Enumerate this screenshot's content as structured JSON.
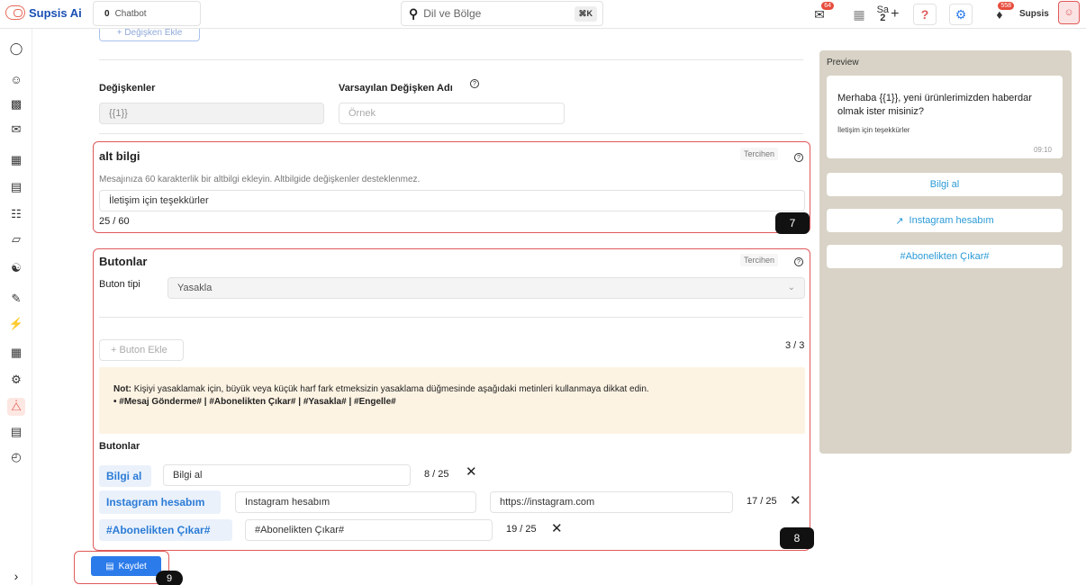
{
  "topbar": {
    "brand": "Supsis Ai",
    "chatbot_count": "0",
    "chatbot_label": "Chatbot",
    "search_placeholder": "Dil ve Bölge",
    "search_shortcut": "⌘K",
    "mail_badge": "64",
    "bell_badge": "558",
    "lang_label": "Sa",
    "lang_sub": "2",
    "user_name": "Supsis"
  },
  "previous": {
    "add_variable_label": "+ Değişken Ekle"
  },
  "variables": {
    "label": "Değişkenler",
    "default_label": "Varsayılan Değişken Adı",
    "value": "{{1}}",
    "default_placeholder": "Örnek"
  },
  "footer_section": {
    "title": "alt bilgi",
    "badge": "Tercihen",
    "description": "Mesajınıza 60 karakterlik bir altbilgi ekleyin. Altbilgide değişkenler desteklenmez.",
    "value": "İletişim için teşekkürler",
    "counter": "25 / 60",
    "tag": "7"
  },
  "buttons_section": {
    "title": "Butonlar",
    "badge": "Tercihen",
    "type_label": "Buton tipi",
    "type_value": "Yasakla",
    "add_button_label": "+ Buton Ekle",
    "count": "3 / 3",
    "note_prefix": "Not:",
    "note_text": " Kişiyi yasaklamak için, büyük veya küçük harf fark etmeksizin yasaklama düğmesinde aşağıdaki metinleri kullanmaya dikkat edin.",
    "note_bullet": "#Mesaj Gönderme# | #Abonelikten Çıkar# | #Yasakla# | #Engelle#",
    "list_label": "Butonlar",
    "items": [
      {
        "chip": "Bilgi al",
        "text": "Bilgi al",
        "counter": "8 / 25"
      },
      {
        "chip": "Instagram hesabım",
        "text": "Instagram hesabım",
        "url": "https://instagram.com",
        "counter": "17 / 25"
      },
      {
        "chip": "#Abonelikten Çıkar#",
        "text": "#Abonelikten Çıkar#",
        "counter": "19 / 25"
      }
    ],
    "tag": "8"
  },
  "save": {
    "label": "Kaydet",
    "tag": "9"
  },
  "preview": {
    "title": "Preview",
    "message": "Merhaba {{1}}, yeni ürünlerimizden haberdar olmak ister misiniz?",
    "footer": "İletişim için teşekkürler",
    "time": "09:10",
    "buttons": [
      "Bilgi al",
      "Instagram hesabım",
      "#Abonelikten Çıkar#"
    ]
  },
  "colors": {
    "accent": "#2b7bea",
    "highlight": "#e05a5a",
    "preview_bg": "#d8d3c6"
  }
}
